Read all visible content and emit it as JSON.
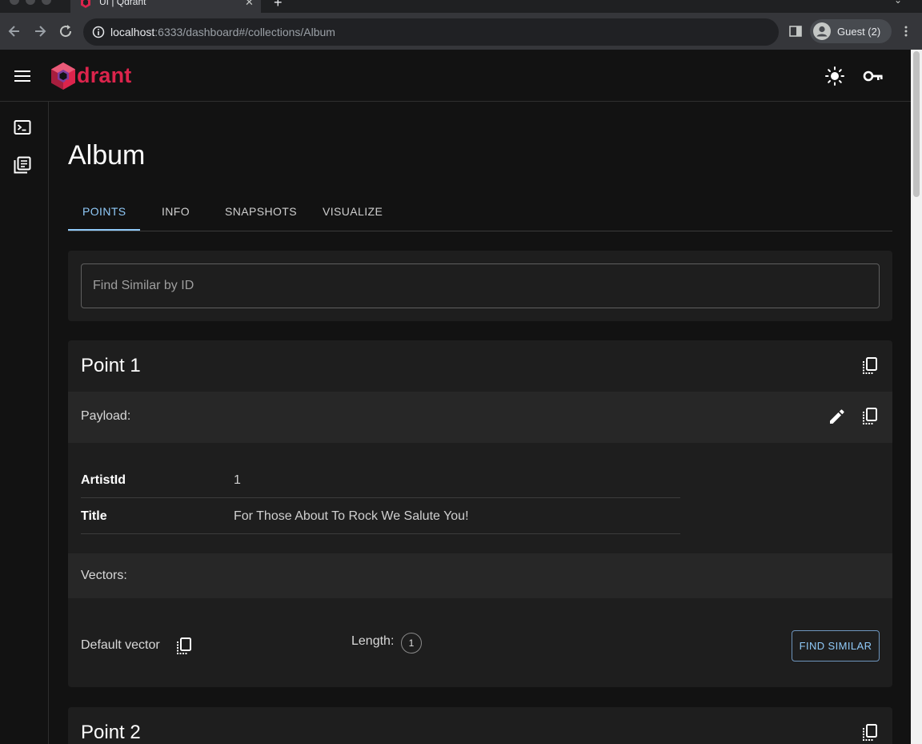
{
  "browser": {
    "tab_title": "UI | Qdrant",
    "url_host": "localhost",
    "url_path": ":6333/dashboard#/collections/Album",
    "profile_label": "Guest (2)"
  },
  "app": {
    "logo_text": "drant"
  },
  "page": {
    "title": "Album",
    "tabs": [
      {
        "label": "POINTS"
      },
      {
        "label": "INFO"
      },
      {
        "label": "SNAPSHOTS"
      },
      {
        "label": "VISUALIZE"
      }
    ],
    "search": {
      "placeholder": "Find Similar by ID"
    }
  },
  "points": [
    {
      "title": "Point 1",
      "payload_label": "Payload:",
      "payload": [
        {
          "key": "ArtistId",
          "value": "1"
        },
        {
          "key": "Title",
          "value": "For Those About To Rock We Salute You!"
        }
      ],
      "vectors_label": "Vectors:",
      "vector": {
        "name": "Default vector",
        "length_label": "Length:",
        "length": "1",
        "find_similar_label": "FIND SIMILAR"
      }
    },
    {
      "title": "Point 2"
    }
  ],
  "colors": {
    "accent": "#90caf9",
    "brand": "#dc244c",
    "background": "#121212",
    "card": "#1e1e1e"
  }
}
